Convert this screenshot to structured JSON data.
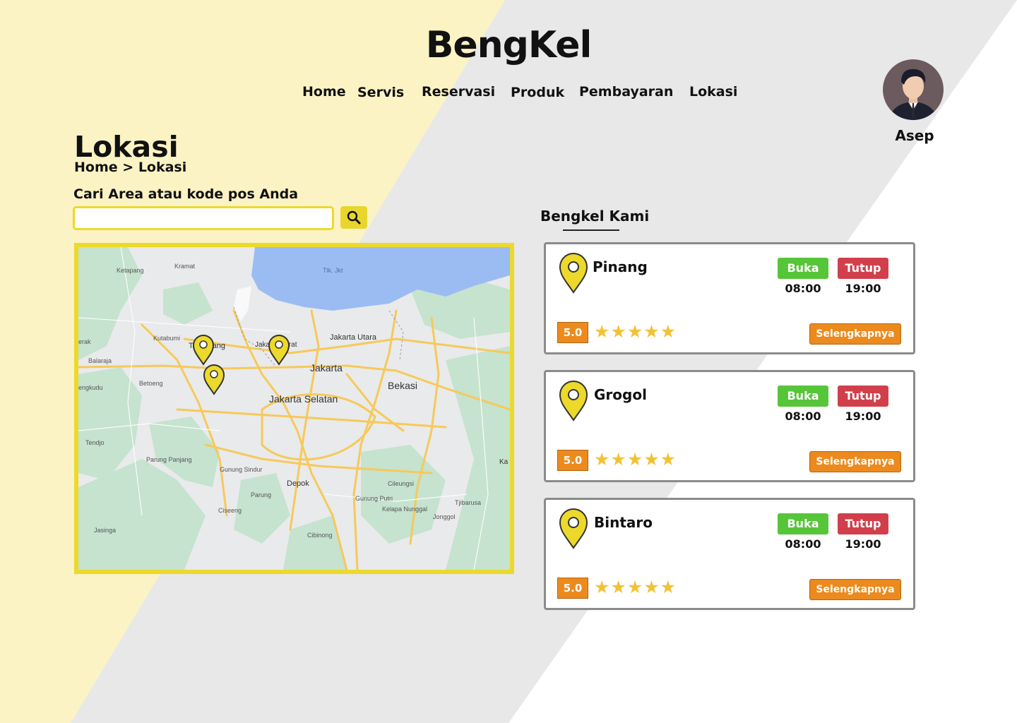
{
  "app": {
    "title": "BengKel"
  },
  "nav": [
    {
      "label": "Home"
    },
    {
      "label": "Servis"
    },
    {
      "label": "Reservasi"
    },
    {
      "label": "Produk"
    },
    {
      "label": "Pembayaran"
    },
    {
      "label": "Lokasi"
    }
  ],
  "user": {
    "name": "Asep"
  },
  "page": {
    "title": "Lokasi",
    "breadcrumb": [
      "Home",
      "Lokasi"
    ],
    "breadcrumb_separator": ">"
  },
  "search": {
    "label": "Cari Area atau kode pos Anda",
    "value": "",
    "placeholder": "",
    "button_icon": "search-icon"
  },
  "map": {
    "sea_label": "Tlk. Jkt",
    "labels": [
      "Ketapang",
      "Kramat",
      "Kutabumi",
      "Tangerang",
      "Jakarta Barat",
      "Jakarta Utara",
      "Jakarta",
      "Bekasi",
      "Jakarta Selatan",
      "Balaraja",
      "Betoeng",
      "Tendjo",
      "Parung Panjang",
      "Gunung Sindur",
      "Depok",
      "Parung",
      "Gunung Putri",
      "Cileungsi",
      "Tjibarusa",
      "Ciseeng",
      "Kelapa Nunggal",
      "Jonggol",
      "Jasinga",
      "Cibinong",
      "Ka",
      "erak",
      "engkudu"
    ]
  },
  "branches": {
    "title": "Bengkel Kami",
    "items": [
      {
        "name": "Pinang",
        "open_label": "Buka",
        "close_label": "Tutup",
        "open_time": "08:00",
        "close_time": "19:00",
        "rating": "5.0",
        "stars": "★★★★★",
        "button": "Selengkapnya"
      },
      {
        "name": "Grogol",
        "open_label": "Buka",
        "close_label": "Tutup",
        "open_time": "08:00",
        "close_time": "19:00",
        "rating": "5.0",
        "stars": "★★★★★",
        "button": "Selengkapnya"
      },
      {
        "name": "Bintaro",
        "open_label": "Buka",
        "close_label": "Tutup",
        "open_time": "08:00",
        "close_time": "19:00",
        "rating": "5.0",
        "stars": "★★★★★",
        "button": "Selengkapnya"
      }
    ]
  },
  "colors": {
    "accent_yellow": "#ecd92a",
    "open_green": "#57c539",
    "closed_red": "#d23f4c",
    "orange": "#ec8a1e",
    "star": "#f2c234"
  }
}
